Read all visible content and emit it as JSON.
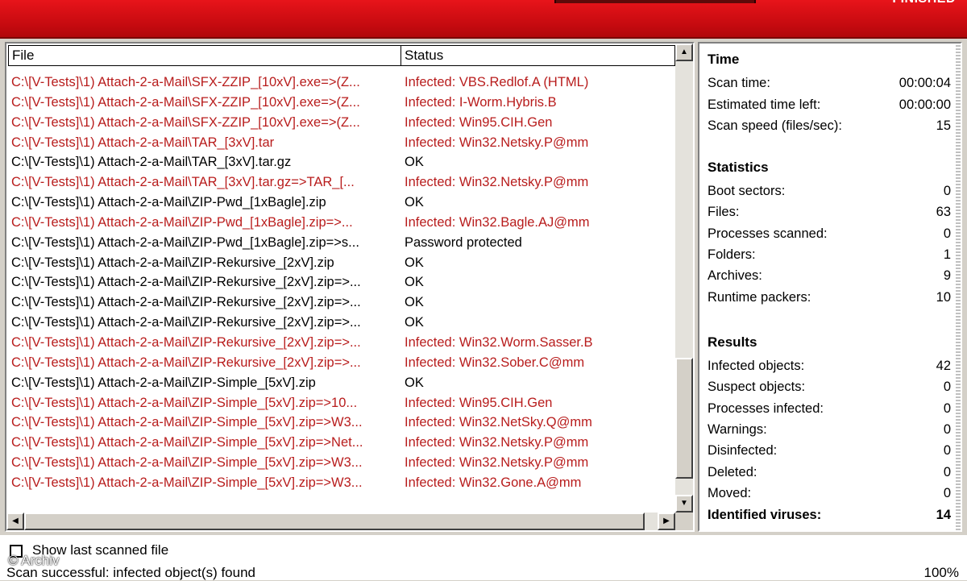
{
  "header": {
    "status_word": "FINISHED"
  },
  "columns": {
    "file": "File",
    "status": "Status"
  },
  "rows": [
    {
      "file": "C:\\[V-Tests]\\1) Attach-2-a-Mail\\SFX-ZZIP_[10xV].exe=>(Z...",
      "status": "Infected: VBS.Redlof.A (HTML)",
      "infected": true
    },
    {
      "file": "C:\\[V-Tests]\\1) Attach-2-a-Mail\\SFX-ZZIP_[10xV].exe=>(Z...",
      "status": "Infected: I-Worm.Hybris.B",
      "infected": true
    },
    {
      "file": "C:\\[V-Tests]\\1) Attach-2-a-Mail\\SFX-ZZIP_[10xV].exe=>(Z...",
      "status": "Infected: Win95.CIH.Gen",
      "infected": true
    },
    {
      "file": "C:\\[V-Tests]\\1) Attach-2-a-Mail\\TAR_[3xV].tar",
      "status": "Infected: Win32.Netsky.P@mm",
      "infected": true
    },
    {
      "file": "C:\\[V-Tests]\\1) Attach-2-a-Mail\\TAR_[3xV].tar.gz",
      "status": "OK",
      "infected": false
    },
    {
      "file": "C:\\[V-Tests]\\1) Attach-2-a-Mail\\TAR_[3xV].tar.gz=>TAR_[...",
      "status": "Infected: Win32.Netsky.P@mm",
      "infected": true
    },
    {
      "file": "C:\\[V-Tests]\\1) Attach-2-a-Mail\\ZIP-Pwd_[1xBagle].zip",
      "status": "OK",
      "infected": false
    },
    {
      "file": "C:\\[V-Tests]\\1) Attach-2-a-Mail\\ZIP-Pwd_[1xBagle].zip=>...",
      "status": "Infected: Win32.Bagle.AJ@mm",
      "infected": true
    },
    {
      "file": "C:\\[V-Tests]\\1) Attach-2-a-Mail\\ZIP-Pwd_[1xBagle].zip=>s...",
      "status": "Password protected",
      "infected": false
    },
    {
      "file": "C:\\[V-Tests]\\1) Attach-2-a-Mail\\ZIP-Rekursive_[2xV].zip",
      "status": "OK",
      "infected": false
    },
    {
      "file": "C:\\[V-Tests]\\1) Attach-2-a-Mail\\ZIP-Rekursive_[2xV].zip=>...",
      "status": "OK",
      "infected": false
    },
    {
      "file": "C:\\[V-Tests]\\1) Attach-2-a-Mail\\ZIP-Rekursive_[2xV].zip=>...",
      "status": "OK",
      "infected": false
    },
    {
      "file": "C:\\[V-Tests]\\1) Attach-2-a-Mail\\ZIP-Rekursive_[2xV].zip=>...",
      "status": "OK",
      "infected": false
    },
    {
      "file": "C:\\[V-Tests]\\1) Attach-2-a-Mail\\ZIP-Rekursive_[2xV].zip=>...",
      "status": "Infected: Win32.Worm.Sasser.B",
      "infected": true
    },
    {
      "file": "C:\\[V-Tests]\\1) Attach-2-a-Mail\\ZIP-Rekursive_[2xV].zip=>...",
      "status": "Infected: Win32.Sober.C@mm",
      "infected": true
    },
    {
      "file": "C:\\[V-Tests]\\1) Attach-2-a-Mail\\ZIP-Simple_[5xV].zip",
      "status": "OK",
      "infected": false
    },
    {
      "file": "C:\\[V-Tests]\\1) Attach-2-a-Mail\\ZIP-Simple_[5xV].zip=>10...",
      "status": "Infected: Win95.CIH.Gen",
      "infected": true
    },
    {
      "file": "C:\\[V-Tests]\\1) Attach-2-a-Mail\\ZIP-Simple_[5xV].zip=>W3...",
      "status": "Infected: Win32.NetSky.Q@mm",
      "infected": true
    },
    {
      "file": "C:\\[V-Tests]\\1) Attach-2-a-Mail\\ZIP-Simple_[5xV].zip=>Net...",
      "status": "Infected: Win32.Netsky.P@mm",
      "infected": true
    },
    {
      "file": "C:\\[V-Tests]\\1) Attach-2-a-Mail\\ZIP-Simple_[5xV].zip=>W3...",
      "status": "Infected: Win32.Netsky.P@mm",
      "infected": true
    },
    {
      "file": "C:\\[V-Tests]\\1) Attach-2-a-Mail\\ZIP-Simple_[5xV].zip=>W3...",
      "status": "Infected: Win32.Gone.A@mm",
      "infected": true
    }
  ],
  "stats": {
    "time_title": "Time",
    "time": [
      {
        "label": "Scan time:",
        "value": "00:00:04"
      },
      {
        "label": "Estimated time left:",
        "value": "00:00:00"
      },
      {
        "label": "Scan speed (files/sec):",
        "value": "15"
      }
    ],
    "statistics_title": "Statistics",
    "statistics": [
      {
        "label": "Boot sectors:",
        "value": "0"
      },
      {
        "label": "Files:",
        "value": "63"
      },
      {
        "label": "Processes scanned:",
        "value": "0"
      },
      {
        "label": "Folders:",
        "value": "1"
      },
      {
        "label": "Archives:",
        "value": "9"
      },
      {
        "label": "Runtime packers:",
        "value": "10"
      }
    ],
    "results_title": "Results",
    "results": [
      {
        "label": "Infected objects:",
        "value": "42"
      },
      {
        "label": "Suspect objects:",
        "value": "0"
      },
      {
        "label": "Processes infected:",
        "value": "0"
      },
      {
        "label": "Warnings:",
        "value": "0"
      },
      {
        "label": "Disinfected:",
        "value": "0"
      },
      {
        "label": "Deleted:",
        "value": "0"
      },
      {
        "label": "Moved:",
        "value": "0"
      }
    ],
    "identified": {
      "label": "Identified viruses:",
      "value": "14"
    }
  },
  "bottom": {
    "checkbox_label": "Show last scanned file",
    "checkbox_checked": false,
    "watermark": "© Archiv",
    "status_text": "Scan successful: infected object(s) found",
    "percent": "100%"
  },
  "colors": {
    "infected": "#b81c1c",
    "header": "#d0101a"
  }
}
